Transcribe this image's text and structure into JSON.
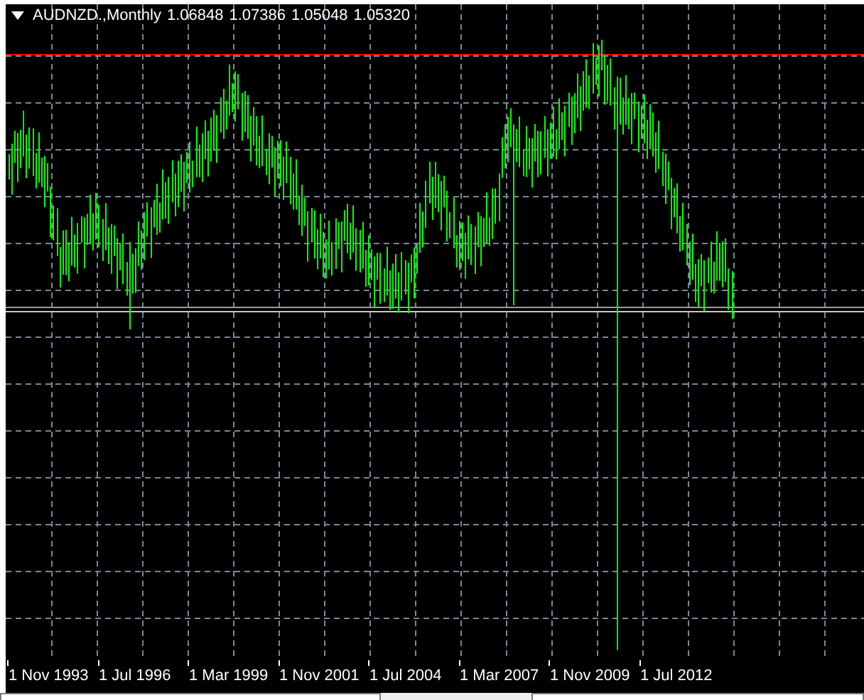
{
  "chart": {
    "symbol_timeframe": "AUDNZD.,Monthly",
    "ohlc": [
      "1.06848",
      "1.07386",
      "1.05048",
      "1.05320"
    ]
  },
  "time_axis": [
    "1 Nov 1993",
    "1 Jul 1996",
    "1 Mar 1999",
    "1 Nov 2001",
    "1 Jul 2004",
    "1 Mar 2007",
    "1 Nov 2009",
    "1 Jul 2012"
  ]
}
